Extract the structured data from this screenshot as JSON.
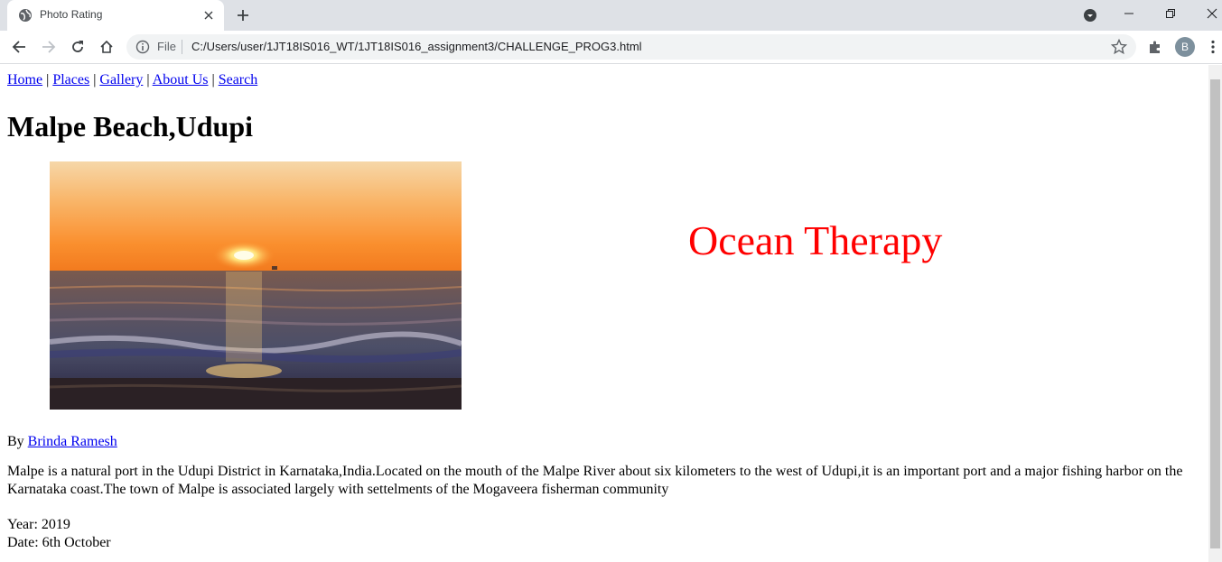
{
  "browser": {
    "tab_title": "Photo Rating",
    "omnibox_scheme": "File",
    "url": "C:/Users/user/1JT18IS016_WT/1JT18IS016_assignment3/CHALLENGE_PROG3.html",
    "profile_initial": "B"
  },
  "nav": {
    "items": [
      "Home",
      "Places",
      "Gallery",
      "About Us",
      "Search"
    ],
    "separator": " | "
  },
  "page": {
    "title": "Malpe Beach,Udupi",
    "tagline": "Ocean Therapy",
    "tagline_color": "#ff0000",
    "by_label": "By",
    "author": "Brinda Ramesh",
    "description": "Malpe is a natural port in the Udupi District in Karnataka,India.Located on the mouth of the Malpe River about six kilometers to the west of Udupi,it is an important port and a major fishing harbor on the Karnataka coast.The town of Malpe is associated largely with settelments of the Mogaveera fisherman community",
    "year": "Year: 2019",
    "date": "Date: 6th October"
  }
}
